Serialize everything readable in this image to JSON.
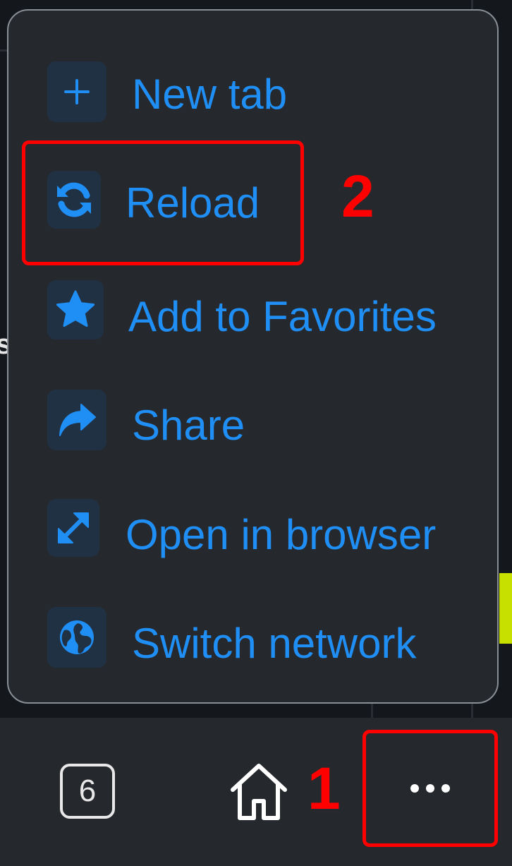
{
  "menu": {
    "items": [
      {
        "label": "New tab",
        "icon": "plus-icon"
      },
      {
        "label": "Reload",
        "icon": "reload-icon"
      },
      {
        "label": "Add to Favorites",
        "icon": "star-icon"
      },
      {
        "label": "Share",
        "icon": "share-icon"
      },
      {
        "label": "Open in browser",
        "icon": "expand-icon"
      },
      {
        "label": "Switch network",
        "icon": "globe-icon"
      }
    ]
  },
  "toolbar": {
    "tab_count": "6",
    "home_icon": "home-icon",
    "more_icon": "more-dots-icon"
  },
  "annotations": {
    "step1": "1",
    "step2": "2"
  },
  "colors": {
    "accent": "#1f8ef5",
    "menu_bg": "#25282d",
    "icon_bg": "#213144",
    "annotation": "#ff0000"
  }
}
